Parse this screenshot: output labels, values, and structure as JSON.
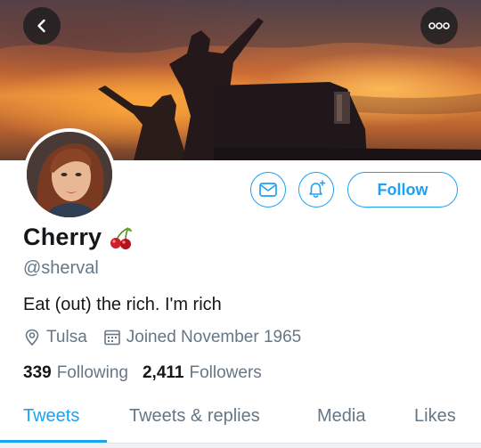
{
  "header": {
    "back_icon": "chevron-left-icon",
    "more_icon": "more-dots-icon"
  },
  "profile": {
    "name": "Cherry",
    "name_emoji": "cherries-emoji",
    "handle": "@sherval",
    "bio": "Eat (out) the rich. I'm rich",
    "location": "Tulsa",
    "joined": "Joined November 1965",
    "following_count": "339",
    "following_label": "Following",
    "followers_count": "2,411",
    "followers_label": "Followers"
  },
  "actions": {
    "follow_label": "Follow",
    "mail_icon": "mail-icon",
    "bell_icon": "bell-plus-icon"
  },
  "tabs": [
    {
      "label": "Tweets",
      "active": true
    },
    {
      "label": "Tweets & replies",
      "active": false
    },
    {
      "label": "Media",
      "active": false
    },
    {
      "label": "Likes",
      "active": false
    }
  ],
  "colors": {
    "accent": "#1da1f2",
    "secondary_text": "#657786",
    "primary_text": "#14171a"
  }
}
